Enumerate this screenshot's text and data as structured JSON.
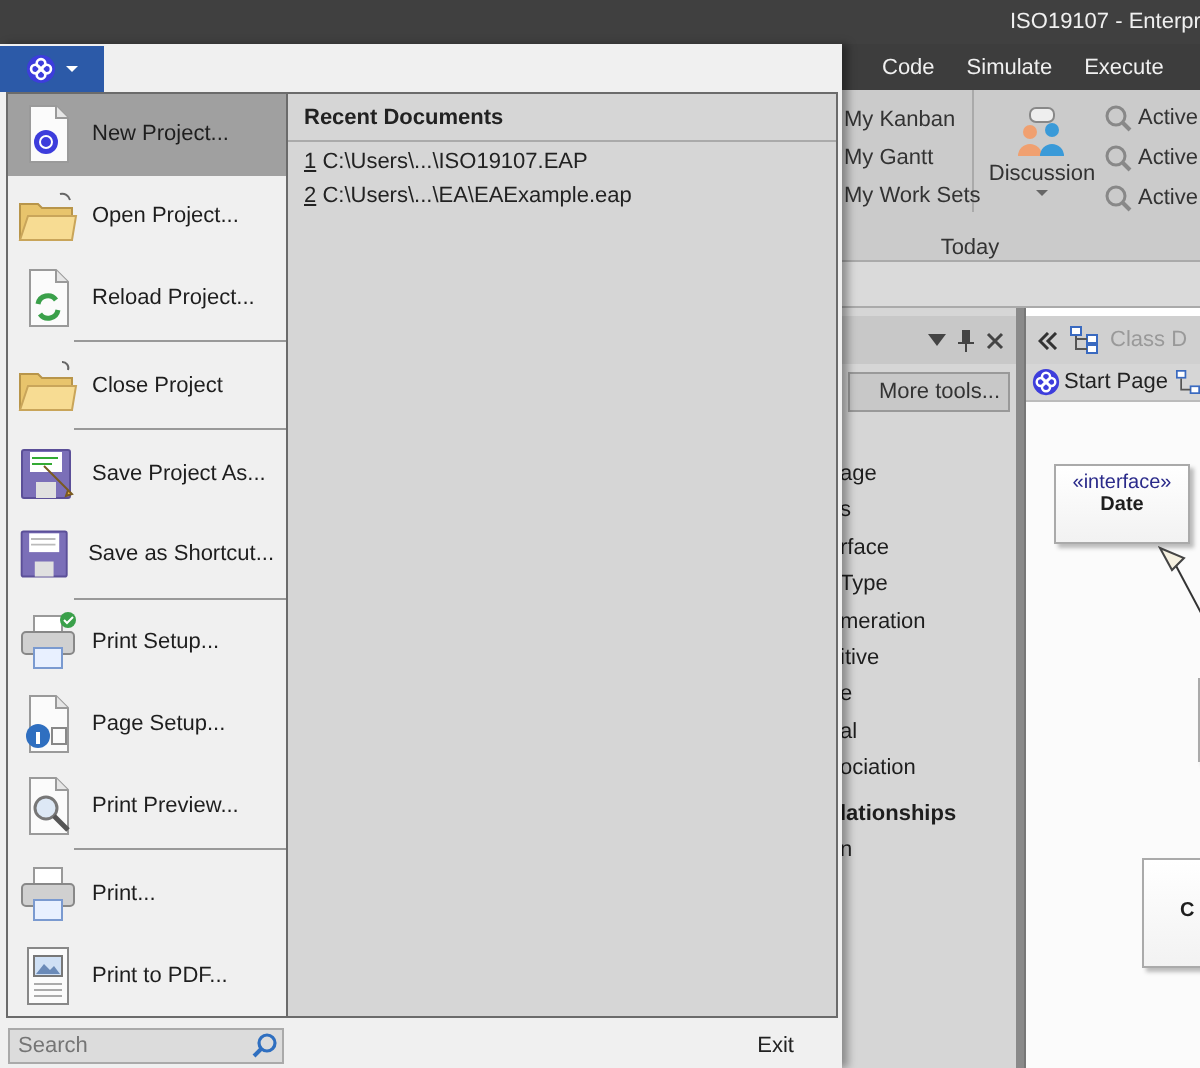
{
  "window": {
    "title": "ISO19107 - Enterpr"
  },
  "ribbon_tabs": [
    {
      "label": "Code"
    },
    {
      "label": "Simulate"
    },
    {
      "label": "Execute"
    }
  ],
  "ribbon": {
    "today_items": [
      "My Kanban",
      "My Gantt",
      "My Work Sets"
    ],
    "discussion": "Discussion",
    "active_items": [
      "Active",
      "Active",
      "Active"
    ],
    "group_label": "Today"
  },
  "toolbox": {
    "more_tools": "More tools...",
    "items": [
      {
        "label": "age",
        "kind": "item"
      },
      {
        "label": "s",
        "kind": "item"
      },
      {
        "label": "rface",
        "kind": "item"
      },
      {
        "label": "Type",
        "kind": "item"
      },
      {
        "label": "meration",
        "kind": "item"
      },
      {
        "label": "itive",
        "kind": "item"
      },
      {
        "label": "e",
        "kind": "item"
      },
      {
        "label": "al",
        "kind": "item"
      },
      {
        "label": "ociation",
        "kind": "item"
      },
      {
        "label": "lationships",
        "kind": "heading"
      },
      {
        "label": "n",
        "kind": "item"
      }
    ]
  },
  "diagram": {
    "title": "Class D",
    "tab": "Start Page",
    "elements": [
      {
        "stereotype": "«interface»",
        "name": "Date"
      },
      {
        "name": "C"
      }
    ]
  },
  "app_menu": {
    "items": [
      {
        "label": "New Project...",
        "selected": true,
        "separator_after": false
      },
      {
        "label": "Open Project...",
        "selected": false,
        "separator_after": false
      },
      {
        "label": "Reload Project...",
        "selected": false,
        "separator_after": true
      },
      {
        "label": "Close Project",
        "selected": false,
        "separator_after": true
      },
      {
        "label": "Save Project As...",
        "selected": false,
        "separator_after": false
      },
      {
        "label": "Save as Shortcut...",
        "selected": false,
        "separator_after": true
      },
      {
        "label": "Print Setup...",
        "selected": false,
        "separator_after": false
      },
      {
        "label": "Page Setup...",
        "selected": false,
        "separator_after": false
      },
      {
        "label": "Print Preview...",
        "selected": false,
        "separator_after": true
      },
      {
        "label": "Print...",
        "selected": false,
        "separator_after": false
      },
      {
        "label": "Print to PDF...",
        "selected": false,
        "separator_after": false
      }
    ],
    "recent_title": "Recent Documents",
    "recent": [
      {
        "number": "1",
        "path": "C:\\Users\\...\\ISO19107.EAP"
      },
      {
        "number": "2",
        "path": "C:\\Users\\...\\EA\\EAExample.eap"
      }
    ],
    "search": {
      "placeholder": "Search"
    },
    "exit": "Exit"
  }
}
